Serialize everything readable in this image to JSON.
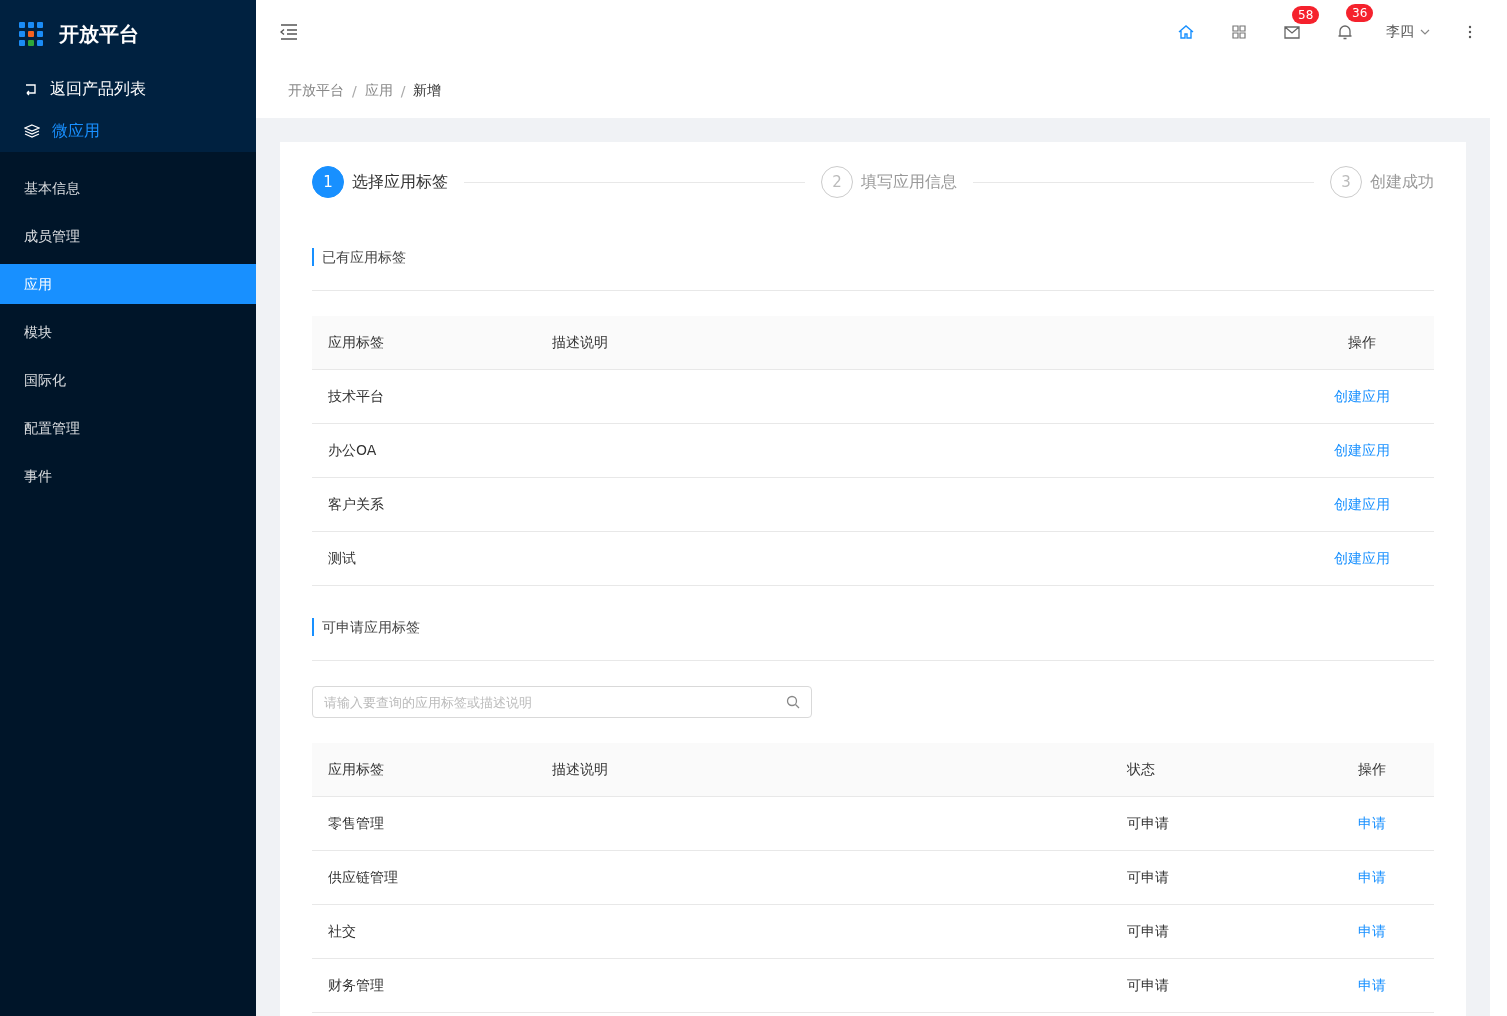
{
  "sidebar": {
    "logo": "开放平台",
    "back": "返回产品列表",
    "product": "微应用",
    "items": [
      {
        "label": "基本信息",
        "selected": false
      },
      {
        "label": "成员管理",
        "selected": false
      },
      {
        "label": "应用",
        "selected": true
      },
      {
        "label": "模块",
        "selected": false
      },
      {
        "label": "国际化",
        "selected": false
      },
      {
        "label": "配置管理",
        "selected": false
      },
      {
        "label": "事件",
        "selected": false
      }
    ]
  },
  "header": {
    "mail_badge": "58",
    "bell_badge": "36",
    "user": "李四"
  },
  "breadcrumb": [
    "开放平台",
    "应用",
    "新增"
  ],
  "breadcrumb_separator": "/",
  "steps": [
    {
      "number": "1",
      "label": "选择应用标签",
      "selected": true
    },
    {
      "number": "2",
      "label": "填写应用信息",
      "selected": false
    },
    {
      "number": "3",
      "label": "创建成功",
      "selected": false
    }
  ],
  "existing": {
    "title": "已有应用标签",
    "columns": [
      "应用标签",
      "描述说明",
      "操作"
    ],
    "rows": [
      {
        "tag": "技术平台",
        "action": "创建应用"
      },
      {
        "tag": "办公OA",
        "action": "创建应用"
      },
      {
        "tag": "客户关系",
        "action": "创建应用"
      },
      {
        "tag": "测试",
        "action": "创建应用"
      }
    ]
  },
  "available": {
    "title": "可申请应用标签",
    "search": {
      "placeholder": "请输入要查询的应用标签或描述说明"
    },
    "columns": [
      "应用标签",
      "描述说明",
      "状态",
      "操作"
    ],
    "rows": [
      {
        "tag": "零售管理",
        "status": "可申请",
        "action": "申请"
      },
      {
        "tag": "供应链管理",
        "status": "可申请",
        "action": "申请"
      },
      {
        "tag": "社交",
        "status": "可申请",
        "action": "申请"
      },
      {
        "tag": "财务管理",
        "status": "可申请",
        "action": "申请"
      }
    ]
  }
}
